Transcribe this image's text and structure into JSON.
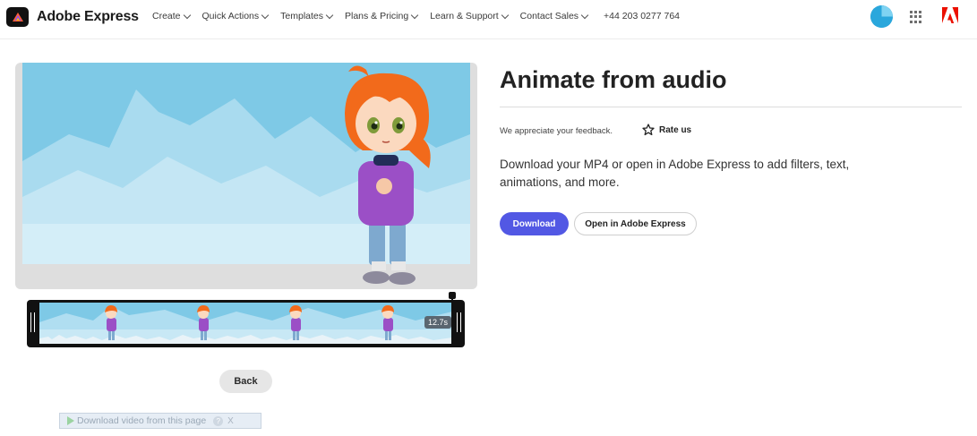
{
  "brand": {
    "name": "Adobe Express"
  },
  "nav": {
    "items": [
      {
        "label": "Create"
      },
      {
        "label": "Quick Actions"
      },
      {
        "label": "Templates"
      },
      {
        "label": "Plans & Pricing"
      },
      {
        "label": "Learn & Support"
      },
      {
        "label": "Contact Sales"
      }
    ],
    "phone": "+44 203 0277 764"
  },
  "icons": {
    "brand_logo": "adobe-express-logo-icon",
    "avatar": "user-avatar",
    "apps": "apps-grid-icon",
    "adobe": "adobe-logo-icon",
    "star": "star-outline-icon",
    "play": "play-icon",
    "help": "help-icon",
    "close": "close-icon"
  },
  "colors": {
    "primary_button": "#5258e4",
    "sky": "#7ec9e6",
    "hair": "#f26a1b",
    "sweater": "#9b4fc6"
  },
  "main": {
    "title": "Animate from audio",
    "feedback_text": "We appreciate your feedback.",
    "rate_label": "Rate us",
    "description": "Download your MP4 or open in Adobe Express to add filters, text, animations, and more.",
    "download_label": "Download",
    "open_label": "Open in Adobe Express"
  },
  "timeline": {
    "duration": "12.7s"
  },
  "back_label": "Back",
  "download_bar": {
    "text": "Download video from this page",
    "help": "?",
    "close": "X"
  }
}
